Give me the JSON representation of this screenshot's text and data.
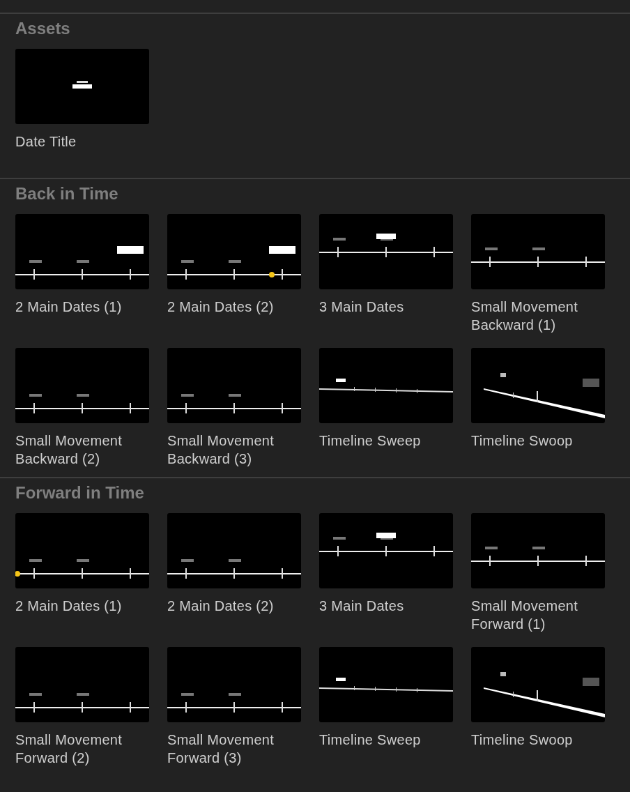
{
  "sections": [
    {
      "title": "Assets",
      "items": [
        {
          "label": "Date Title",
          "kind": "picture"
        }
      ]
    },
    {
      "title": "Back in Time",
      "items": [
        {
          "label": "2 Main Dates (1)",
          "kind": "picture"
        },
        {
          "label": "2 Main Dates (2)",
          "kind": "picture"
        },
        {
          "label": "3 Main Dates",
          "kind": "picture"
        },
        {
          "label": "Small Movement Backward (1)",
          "kind": "picture"
        },
        {
          "label": "Small Movement Backward (2)",
          "kind": "picture"
        },
        {
          "label": "Small Movement Backward (3)",
          "kind": "picture"
        },
        {
          "label": "Timeline Sweep",
          "kind": "picture"
        },
        {
          "label": "Timeline Swoop",
          "kind": "picture"
        }
      ]
    },
    {
      "title": "Forward in Time",
      "items": [
        {
          "label": "2 Main Dates (1)",
          "kind": "picture"
        },
        {
          "label": "2 Main Dates (2)",
          "kind": "picture"
        },
        {
          "label": "3 Main Dates",
          "kind": "picture"
        },
        {
          "label": "Small Movement Forward (1)",
          "kind": "picture"
        },
        {
          "label": "Small Movement Forward (2)",
          "kind": "picture"
        },
        {
          "label": "Small Movement Forward (3)",
          "kind": "picture"
        },
        {
          "label": "Timeline Sweep",
          "kind": "picture"
        },
        {
          "label": "Timeline Swoop",
          "kind": "picture"
        }
      ]
    }
  ]
}
